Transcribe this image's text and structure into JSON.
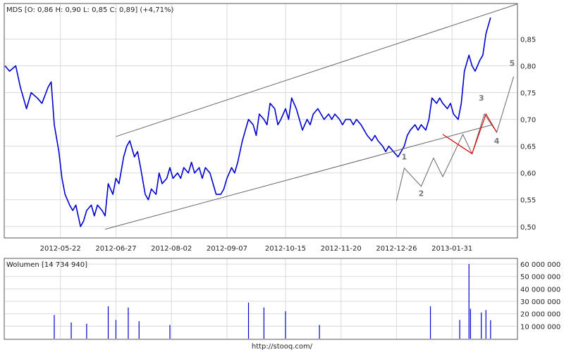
{
  "header": {
    "price_label": "MDS [O: 0,86  H: 0,90  L: 0,85  C: 0,89] (+4,71%)",
    "volume_label": "Wolumen [14 734 940]",
    "footer_url": "http://stooq.com/"
  },
  "colors": {
    "price": "#0000cc",
    "volume": "#0000cc",
    "channel": "#666666",
    "wave_forecast": "#e00000",
    "wave_projection": "#666666",
    "grid": "#d9d9d9",
    "frame": "#555555"
  },
  "chart_data": [
    {
      "type": "line",
      "title": "MDS [O: 0,86  H: 0,90  L: 0,85  C: 0,89] (+4,71%)",
      "xlabel": "",
      "ylabel": "",
      "ylim": [
        0.48,
        0.915
      ],
      "grid": true,
      "x_ticks": [
        "2012-05-22",
        "2012-06-27",
        "2012-08-02",
        "2012-09-07",
        "2012-10-15",
        "2012-11-20",
        "2012-12-26",
        "2013-01-31"
      ],
      "y_ticks": [
        "0,50",
        "0,55",
        "0,60",
        "0,65",
        "0,70",
        "0,75",
        "0,80",
        "0,85"
      ],
      "y_tick_values": [
        0.5,
        0.55,
        0.6,
        0.65,
        0.7,
        0.75,
        0.8,
        0.85
      ],
      "x_range": [
        "2012-04-16",
        "2013-03-14"
      ],
      "series": [
        {
          "values": [
            [
              "2012-04-16",
              0.8
            ],
            [
              "2012-04-19",
              0.79
            ],
            [
              "2012-04-23",
              0.8
            ],
            [
              "2012-04-26",
              0.76
            ],
            [
              "2012-04-30",
              0.72
            ],
            [
              "2012-05-03",
              0.75
            ],
            [
              "2012-05-07",
              0.74
            ],
            [
              "2012-05-10",
              0.73
            ],
            [
              "2012-05-14",
              0.76
            ],
            [
              "2012-05-16",
              0.77
            ],
            [
              "2012-05-18",
              0.69
            ],
            [
              "2012-05-21",
              0.64
            ],
            [
              "2012-05-23",
              0.59
            ],
            [
              "2012-05-25",
              0.56
            ],
            [
              "2012-05-28",
              0.54
            ],
            [
              "2012-05-30",
              0.53
            ],
            [
              "2012-06-01",
              0.54
            ],
            [
              "2012-06-04",
              0.5
            ],
            [
              "2012-06-06",
              0.51
            ],
            [
              "2012-06-08",
              0.53
            ],
            [
              "2012-06-11",
              0.54
            ],
            [
              "2012-06-13",
              0.52
            ],
            [
              "2012-06-15",
              0.54
            ],
            [
              "2012-06-18",
              0.53
            ],
            [
              "2012-06-20",
              0.52
            ],
            [
              "2012-06-22",
              0.58
            ],
            [
              "2012-06-25",
              0.56
            ],
            [
              "2012-06-27",
              0.59
            ],
            [
              "2012-06-29",
              0.58
            ],
            [
              "2012-07-02",
              0.63
            ],
            [
              "2012-07-04",
              0.65
            ],
            [
              "2012-07-06",
              0.66
            ],
            [
              "2012-07-09",
              0.63
            ],
            [
              "2012-07-11",
              0.64
            ],
            [
              "2012-07-13",
              0.61
            ],
            [
              "2012-07-16",
              0.56
            ],
            [
              "2012-07-18",
              0.55
            ],
            [
              "2012-07-20",
              0.57
            ],
            [
              "2012-07-23",
              0.56
            ],
            [
              "2012-07-25",
              0.6
            ],
            [
              "2012-07-27",
              0.58
            ],
            [
              "2012-07-30",
              0.59
            ],
            [
              "2012-08-01",
              0.61
            ],
            [
              "2012-08-03",
              0.59
            ],
            [
              "2012-08-06",
              0.6
            ],
            [
              "2012-08-08",
              0.59
            ],
            [
              "2012-08-10",
              0.61
            ],
            [
              "2012-08-13",
              0.6
            ],
            [
              "2012-08-15",
              0.62
            ],
            [
              "2012-08-17",
              0.6
            ],
            [
              "2012-08-20",
              0.61
            ],
            [
              "2012-08-22",
              0.59
            ],
            [
              "2012-08-24",
              0.61
            ],
            [
              "2012-08-27",
              0.6
            ],
            [
              "2012-08-29",
              0.58
            ],
            [
              "2012-08-31",
              0.56
            ],
            [
              "2012-09-03",
              0.56
            ],
            [
              "2012-09-05",
              0.57
            ],
            [
              "2012-09-07",
              0.59
            ],
            [
              "2012-09-10",
              0.61
            ],
            [
              "2012-09-12",
              0.6
            ],
            [
              "2012-09-14",
              0.62
            ],
            [
              "2012-09-17",
              0.66
            ],
            [
              "2012-09-19",
              0.68
            ],
            [
              "2012-09-21",
              0.7
            ],
            [
              "2012-09-24",
              0.69
            ],
            [
              "2012-09-26",
              0.67
            ],
            [
              "2012-09-28",
              0.71
            ],
            [
              "2012-10-01",
              0.7
            ],
            [
              "2012-10-03",
              0.69
            ],
            [
              "2012-10-05",
              0.73
            ],
            [
              "2012-10-08",
              0.72
            ],
            [
              "2012-10-10",
              0.69
            ],
            [
              "2012-10-12",
              0.7
            ],
            [
              "2012-10-15",
              0.72
            ],
            [
              "2012-10-17",
              0.7
            ],
            [
              "2012-10-19",
              0.74
            ],
            [
              "2012-10-22",
              0.72
            ],
            [
              "2012-10-24",
              0.7
            ],
            [
              "2012-10-26",
              0.68
            ],
            [
              "2012-10-29",
              0.7
            ],
            [
              "2012-10-31",
              0.69
            ],
            [
              "2012-11-02",
              0.71
            ],
            [
              "2012-11-05",
              0.72
            ],
            [
              "2012-11-07",
              0.71
            ],
            [
              "2012-11-09",
              0.7
            ],
            [
              "2012-11-12",
              0.71
            ],
            [
              "2012-11-14",
              0.7
            ],
            [
              "2012-11-16",
              0.71
            ],
            [
              "2012-11-19",
              0.7
            ],
            [
              "2012-11-21",
              0.69
            ],
            [
              "2012-11-23",
              0.7
            ],
            [
              "2012-11-26",
              0.7
            ],
            [
              "2012-11-28",
              0.69
            ],
            [
              "2012-11-30",
              0.7
            ],
            [
              "2012-12-03",
              0.69
            ],
            [
              "2012-12-05",
              0.68
            ],
            [
              "2012-12-07",
              0.67
            ],
            [
              "2012-12-10",
              0.66
            ],
            [
              "2012-12-12",
              0.67
            ],
            [
              "2012-12-14",
              0.66
            ],
            [
              "2012-12-17",
              0.65
            ],
            [
              "2012-12-19",
              0.64
            ],
            [
              "2012-12-21",
              0.65
            ],
            [
              "2012-12-24",
              0.64
            ],
            [
              "2012-12-27",
              0.63
            ],
            [
              "2012-12-31",
              0.65
            ],
            [
              "2013-01-02",
              0.67
            ],
            [
              "2013-01-04",
              0.68
            ],
            [
              "2013-01-07",
              0.69
            ],
            [
              "2013-01-09",
              0.68
            ],
            [
              "2013-01-11",
              0.69
            ],
            [
              "2013-01-14",
              0.68
            ],
            [
              "2013-01-16",
              0.7
            ],
            [
              "2013-01-18",
              0.74
            ],
            [
              "2013-01-21",
              0.73
            ],
            [
              "2013-01-23",
              0.74
            ],
            [
              "2013-01-25",
              0.73
            ],
            [
              "2013-01-28",
              0.72
            ],
            [
              "2013-01-30",
              0.73
            ],
            [
              "2013-02-01",
              0.71
            ],
            [
              "2013-02-04",
              0.7
            ],
            [
              "2013-02-06",
              0.73
            ],
            [
              "2013-02-08",
              0.79
            ],
            [
              "2013-02-11",
              0.82
            ],
            [
              "2013-02-13",
              0.8
            ],
            [
              "2013-02-15",
              0.79
            ],
            [
              "2013-02-18",
              0.81
            ],
            [
              "2013-02-20",
              0.82
            ],
            [
              "2013-02-22",
              0.86
            ],
            [
              "2013-02-25",
              0.89
            ]
          ]
        }
      ],
      "channel_lines": [
        {
          "from": [
            "2012-06-27",
            0.668
          ],
          "to": [
            "2013-03-14",
            0.915
          ]
        },
        {
          "from": [
            "2012-06-20",
            0.495
          ],
          "to": [
            "2013-02-26",
            0.69
          ]
        }
      ],
      "wave_forecast": [
        [
          "2013-01-25",
          0.672
        ],
        [
          "2013-02-13",
          0.636
        ],
        [
          "2013-02-22",
          0.71
        ],
        [
          "2013-03-01",
          0.676
        ]
      ],
      "wave_projection": [
        [
          "2012-12-26",
          0.548
        ],
        [
          "2012-12-31",
          0.609
        ],
        [
          "2013-01-11",
          0.575
        ],
        [
          "2013-01-19",
          0.628
        ],
        [
          "2013-01-25",
          0.593
        ],
        [
          "2013-02-07",
          0.672
        ],
        [
          "2013-02-13",
          0.636
        ],
        [
          "2013-02-21",
          0.71
        ],
        [
          "2013-03-01",
          0.676
        ],
        [
          "2013-03-12",
          0.78
        ]
      ],
      "annotations": [
        {
          "text": "1",
          "x": "2012-12-31",
          "y": 0.625
        },
        {
          "text": "2",
          "x": "2013-01-11",
          "y": 0.557
        },
        {
          "text": "3",
          "x": "2013-02-19",
          "y": 0.735
        },
        {
          "text": "4",
          "x": "2013-03-01",
          "y": 0.655
        },
        {
          "text": "5",
          "x": "2013-03-11",
          "y": 0.8
        }
      ]
    },
    {
      "type": "bar",
      "title": "Wolumen [14 734 940]",
      "ylim": [
        0,
        64000000
      ],
      "grid": true,
      "y_ticks": [
        "10 000 000",
        "20 000 000",
        "30 000 000",
        "40 000 000",
        "50 000 000",
        "60 000 000"
      ],
      "y_tick_values": [
        10000000,
        20000000,
        30000000,
        40000000,
        50000000,
        60000000
      ],
      "values": [
        [
          "2012-05-18",
          19000000
        ],
        [
          "2012-05-29",
          13000000
        ],
        [
          "2012-06-08",
          12000000
        ],
        [
          "2012-06-22",
          26000000
        ],
        [
          "2012-06-27",
          15000000
        ],
        [
          "2012-07-05",
          25000000
        ],
        [
          "2012-07-12",
          14000000
        ],
        [
          "2012-08-01",
          11000000
        ],
        [
          "2012-09-21",
          29000000
        ],
        [
          "2012-10-01",
          25000000
        ],
        [
          "2012-10-15",
          22000000
        ],
        [
          "2012-11-06",
          11000000
        ],
        [
          "2013-01-17",
          26000000
        ],
        [
          "2013-02-05",
          15000000
        ],
        [
          "2013-02-11",
          60000000
        ],
        [
          "2013-02-12",
          24000000
        ],
        [
          "2013-02-19",
          21000000
        ],
        [
          "2013-02-22",
          23000000
        ],
        [
          "2013-02-25",
          14734940
        ]
      ]
    }
  ]
}
